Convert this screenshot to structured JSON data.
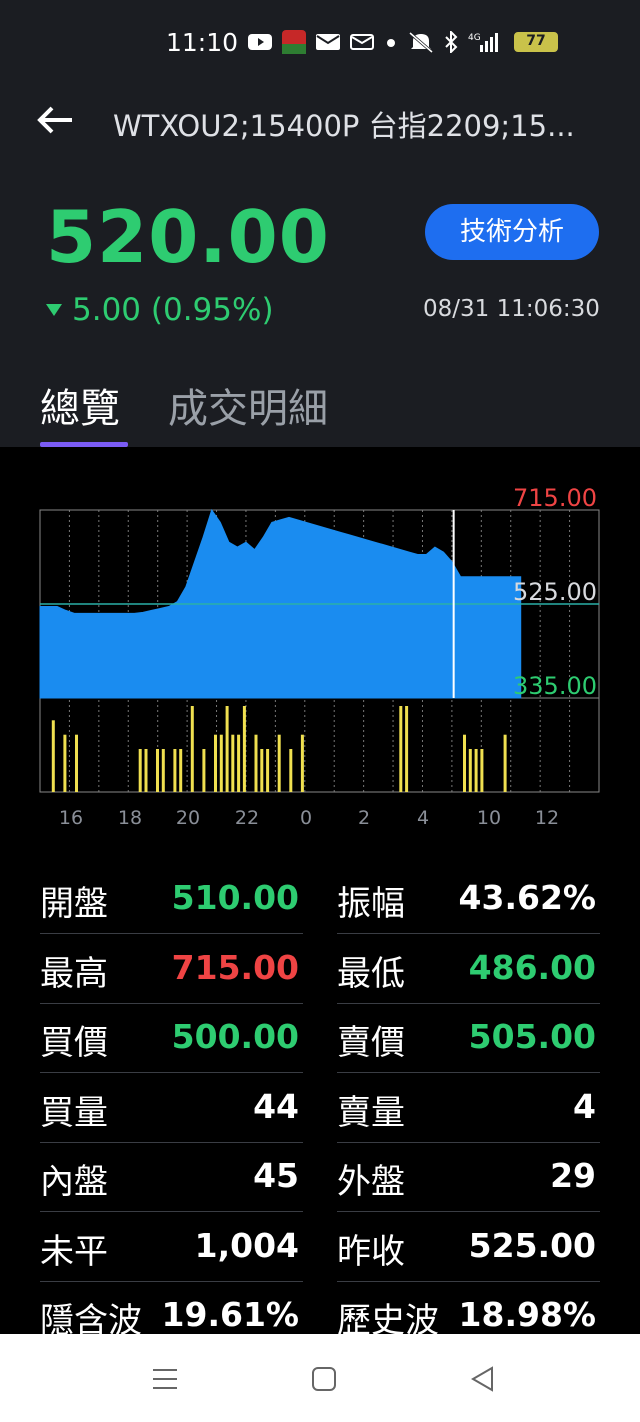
{
  "status_bar": {
    "time": "11:10",
    "battery": "77",
    "icons": [
      "youtube-icon",
      "app-icon",
      "mail-icon",
      "mail-outline-icon",
      "dot-icon",
      "mute-icon",
      "bluetooth-icon",
      "signal-4g-icon",
      "battery-icon"
    ]
  },
  "header": {
    "title": "WTXOU2;15400P 台指2209;15...",
    "price": "520.00",
    "change": "5.00 (0.95%)",
    "timestamp": "08/31 11:06:30",
    "tech_button": "技術分析"
  },
  "tabs": [
    {
      "label": "總覽",
      "active": true
    },
    {
      "label": "成交明細",
      "active": false
    }
  ],
  "chart_data": {
    "type": "area",
    "y_high_label": "715.00",
    "y_mid_label": "525.00",
    "y_low_label": "335.00",
    "ylim": [
      335,
      715
    ],
    "reference": 525,
    "x_ticks": [
      "16",
      "18",
      "20",
      "22",
      "0",
      "2",
      "4",
      "10",
      "12"
    ],
    "price_series": [
      520,
      520,
      520,
      512,
      506,
      506,
      506,
      506,
      506,
      506,
      506,
      506,
      508,
      512,
      516,
      520,
      530,
      560,
      610,
      660,
      715,
      690,
      650,
      640,
      650,
      635,
      660,
      690,
      695,
      700,
      695,
      690,
      685,
      680,
      675,
      670,
      665,
      660,
      655,
      650,
      645,
      640,
      635,
      630,
      625,
      625,
      640,
      630,
      610,
      580,
      580,
      580,
      580,
      580,
      580,
      580,
      580
    ],
    "volume_series": [
      0,
      5,
      0,
      4,
      0,
      4,
      0,
      0,
      0,
      0,
      0,
      0,
      0,
      0,
      0,
      0,
      3,
      3,
      0,
      3,
      3,
      0,
      3,
      3,
      0,
      6,
      0,
      3,
      0,
      4,
      4,
      6,
      4,
      4,
      6,
      0,
      4,
      3,
      3,
      0,
      4,
      0,
      3,
      0,
      4,
      0,
      0,
      0,
      0,
      0,
      0,
      0,
      0,
      0,
      0,
      0,
      0,
      0,
      0,
      0,
      0,
      6,
      6,
      0,
      0,
      0,
      0,
      0,
      0,
      0,
      0,
      0,
      4,
      3,
      3,
      3,
      0,
      0,
      0,
      4,
      0,
      0,
      0
    ]
  },
  "stats_left": [
    {
      "label": "開盤",
      "value": "510.00",
      "color": "#2ecc71"
    },
    {
      "label": "最高",
      "value": "715.00",
      "color": "#ef4444"
    },
    {
      "label": "買價",
      "value": "500.00",
      "color": "#2ecc71"
    },
    {
      "label": "買量",
      "value": "44",
      "color": "#ffffff"
    },
    {
      "label": "內盤",
      "value": "45",
      "color": "#ffffff"
    },
    {
      "label": "未平",
      "value": "1,004",
      "color": "#ffffff"
    },
    {
      "label": "隱含波",
      "value": "19.61%",
      "color": "#ffffff"
    }
  ],
  "stats_right": [
    {
      "label": "振幅",
      "value": "43.62%",
      "color": "#ffffff"
    },
    {
      "label": "最低",
      "value": "486.00",
      "color": "#2ecc71"
    },
    {
      "label": "賣價",
      "value": "505.00",
      "color": "#2ecc71"
    },
    {
      "label": "賣量",
      "value": "4",
      "color": "#ffffff"
    },
    {
      "label": "外盤",
      "value": "29",
      "color": "#ffffff"
    },
    {
      "label": "昨收",
      "value": "525.00",
      "color": "#ffffff"
    },
    {
      "label": "歷史波",
      "value": "18.98%",
      "color": "#ffffff"
    }
  ],
  "nav": [
    "menu-icon",
    "home-icon",
    "back-triangle-icon"
  ]
}
